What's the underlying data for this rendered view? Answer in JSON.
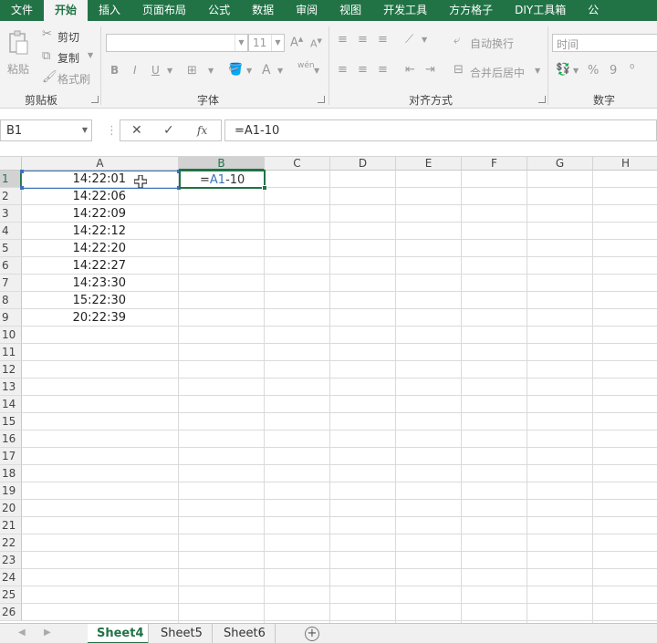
{
  "ribbon_tabs": [
    "文件",
    "开始",
    "插入",
    "页面布局",
    "公式",
    "数据",
    "审阅",
    "视图",
    "开发工具",
    "方方格子",
    "DIY工具箱",
    "公"
  ],
  "active_tab_index": 1,
  "clipboard": {
    "paste": "粘贴",
    "cut": "剪切",
    "copy": "复制",
    "format_painter": "格式刷",
    "label": "剪贴板"
  },
  "font": {
    "name_value": "",
    "size_value": "11",
    "bold": "B",
    "italic": "I",
    "underline": "U",
    "font_color": "A",
    "pinyin": "wén",
    "label": "字体"
  },
  "alignment": {
    "wrap_text": "自动换行",
    "merge_center": "合并后居中",
    "label": "对齐方式"
  },
  "number": {
    "format_value": "时间",
    "percent": "%",
    "comma": "9",
    "label": "数字"
  },
  "formula_bar": {
    "name_box": "B1",
    "cancel": "✕",
    "enter": "✓",
    "fx": "fx",
    "formula": "=A1-10"
  },
  "columns": [
    "A",
    "B",
    "C",
    "D",
    "E",
    "F",
    "G",
    "H"
  ],
  "selected_column": "B",
  "rows": [
    "1",
    "2",
    "3",
    "4",
    "5",
    "6",
    "7",
    "8",
    "9",
    "10",
    "11",
    "12",
    "13",
    "14",
    "15",
    "16",
    "17",
    "18",
    "19",
    "20",
    "21",
    "22",
    "23",
    "24",
    "25",
    "26"
  ],
  "selected_row": "1",
  "column_a_values": [
    "14:22:01",
    "14:22:06",
    "14:22:09",
    "14:22:12",
    "14:22:20",
    "14:22:27",
    "14:23:30",
    "15:22:30",
    "20:22:39"
  ],
  "active_cell_edit": {
    "prefix": "=",
    "ref": "A1",
    "suffix": "-10"
  },
  "sheets": [
    "Sheet4",
    "Sheet5",
    "Sheet6"
  ],
  "active_sheet": "Sheet4",
  "colors": {
    "excel_green": "#217346",
    "ref_blue": "#3b73b9"
  }
}
